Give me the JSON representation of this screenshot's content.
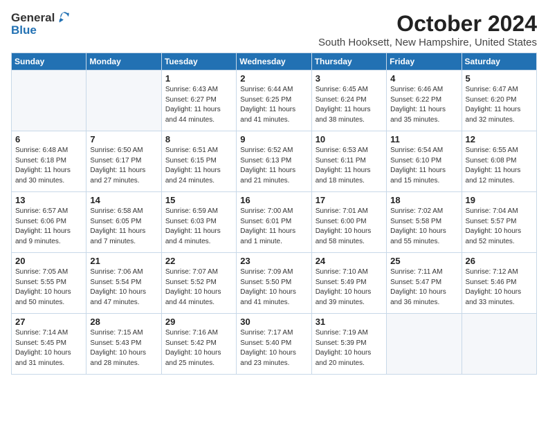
{
  "header": {
    "logo_general": "General",
    "logo_blue": "Blue",
    "month": "October 2024",
    "location": "South Hooksett, New Hampshire, United States"
  },
  "days_of_week": [
    "Sunday",
    "Monday",
    "Tuesday",
    "Wednesday",
    "Thursday",
    "Friday",
    "Saturday"
  ],
  "weeks": [
    [
      {
        "day": "",
        "info": ""
      },
      {
        "day": "",
        "info": ""
      },
      {
        "day": "1",
        "info": "Sunrise: 6:43 AM\nSunset: 6:27 PM\nDaylight: 11 hours and 44 minutes."
      },
      {
        "day": "2",
        "info": "Sunrise: 6:44 AM\nSunset: 6:25 PM\nDaylight: 11 hours and 41 minutes."
      },
      {
        "day": "3",
        "info": "Sunrise: 6:45 AM\nSunset: 6:24 PM\nDaylight: 11 hours and 38 minutes."
      },
      {
        "day": "4",
        "info": "Sunrise: 6:46 AM\nSunset: 6:22 PM\nDaylight: 11 hours and 35 minutes."
      },
      {
        "day": "5",
        "info": "Sunrise: 6:47 AM\nSunset: 6:20 PM\nDaylight: 11 hours and 32 minutes."
      }
    ],
    [
      {
        "day": "6",
        "info": "Sunrise: 6:48 AM\nSunset: 6:18 PM\nDaylight: 11 hours and 30 minutes."
      },
      {
        "day": "7",
        "info": "Sunrise: 6:50 AM\nSunset: 6:17 PM\nDaylight: 11 hours and 27 minutes."
      },
      {
        "day": "8",
        "info": "Sunrise: 6:51 AM\nSunset: 6:15 PM\nDaylight: 11 hours and 24 minutes."
      },
      {
        "day": "9",
        "info": "Sunrise: 6:52 AM\nSunset: 6:13 PM\nDaylight: 11 hours and 21 minutes."
      },
      {
        "day": "10",
        "info": "Sunrise: 6:53 AM\nSunset: 6:11 PM\nDaylight: 11 hours and 18 minutes."
      },
      {
        "day": "11",
        "info": "Sunrise: 6:54 AM\nSunset: 6:10 PM\nDaylight: 11 hours and 15 minutes."
      },
      {
        "day": "12",
        "info": "Sunrise: 6:55 AM\nSunset: 6:08 PM\nDaylight: 11 hours and 12 minutes."
      }
    ],
    [
      {
        "day": "13",
        "info": "Sunrise: 6:57 AM\nSunset: 6:06 PM\nDaylight: 11 hours and 9 minutes."
      },
      {
        "day": "14",
        "info": "Sunrise: 6:58 AM\nSunset: 6:05 PM\nDaylight: 11 hours and 7 minutes."
      },
      {
        "day": "15",
        "info": "Sunrise: 6:59 AM\nSunset: 6:03 PM\nDaylight: 11 hours and 4 minutes."
      },
      {
        "day": "16",
        "info": "Sunrise: 7:00 AM\nSunset: 6:01 PM\nDaylight: 11 hours and 1 minute."
      },
      {
        "day": "17",
        "info": "Sunrise: 7:01 AM\nSunset: 6:00 PM\nDaylight: 10 hours and 58 minutes."
      },
      {
        "day": "18",
        "info": "Sunrise: 7:02 AM\nSunset: 5:58 PM\nDaylight: 10 hours and 55 minutes."
      },
      {
        "day": "19",
        "info": "Sunrise: 7:04 AM\nSunset: 5:57 PM\nDaylight: 10 hours and 52 minutes."
      }
    ],
    [
      {
        "day": "20",
        "info": "Sunrise: 7:05 AM\nSunset: 5:55 PM\nDaylight: 10 hours and 50 minutes."
      },
      {
        "day": "21",
        "info": "Sunrise: 7:06 AM\nSunset: 5:54 PM\nDaylight: 10 hours and 47 minutes."
      },
      {
        "day": "22",
        "info": "Sunrise: 7:07 AM\nSunset: 5:52 PM\nDaylight: 10 hours and 44 minutes."
      },
      {
        "day": "23",
        "info": "Sunrise: 7:09 AM\nSunset: 5:50 PM\nDaylight: 10 hours and 41 minutes."
      },
      {
        "day": "24",
        "info": "Sunrise: 7:10 AM\nSunset: 5:49 PM\nDaylight: 10 hours and 39 minutes."
      },
      {
        "day": "25",
        "info": "Sunrise: 7:11 AM\nSunset: 5:47 PM\nDaylight: 10 hours and 36 minutes."
      },
      {
        "day": "26",
        "info": "Sunrise: 7:12 AM\nSunset: 5:46 PM\nDaylight: 10 hours and 33 minutes."
      }
    ],
    [
      {
        "day": "27",
        "info": "Sunrise: 7:14 AM\nSunset: 5:45 PM\nDaylight: 10 hours and 31 minutes."
      },
      {
        "day": "28",
        "info": "Sunrise: 7:15 AM\nSunset: 5:43 PM\nDaylight: 10 hours and 28 minutes."
      },
      {
        "day": "29",
        "info": "Sunrise: 7:16 AM\nSunset: 5:42 PM\nDaylight: 10 hours and 25 minutes."
      },
      {
        "day": "30",
        "info": "Sunrise: 7:17 AM\nSunset: 5:40 PM\nDaylight: 10 hours and 23 minutes."
      },
      {
        "day": "31",
        "info": "Sunrise: 7:19 AM\nSunset: 5:39 PM\nDaylight: 10 hours and 20 minutes."
      },
      {
        "day": "",
        "info": ""
      },
      {
        "day": "",
        "info": ""
      }
    ]
  ]
}
